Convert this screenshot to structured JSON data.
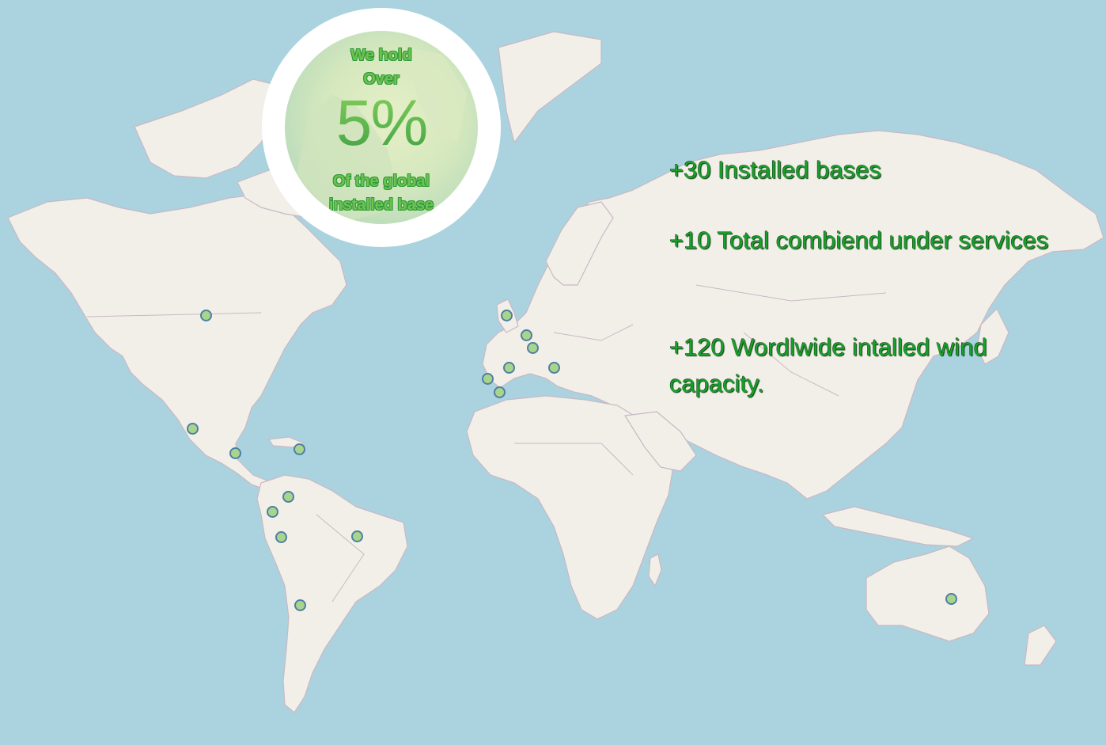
{
  "badge": {
    "line1": "We hold",
    "line2": "Over",
    "percent": "5%",
    "line3": "Of the global",
    "line4": "installed base"
  },
  "stats": {
    "installed_bases": "+30 Installed bases",
    "combined_services": "+10 Total combiend under services",
    "wind_capacity": "+120 Wordlwide intalled wind capacity."
  },
  "colors": {
    "ocean": "#aad3df",
    "land": "#f2efe9",
    "border": "#c9b8c4",
    "marker_fill": "#a8d58c",
    "marker_stroke": "#4f7fa1",
    "text_green": "#19a02a"
  },
  "markers": [
    {
      "name": "marker-canada"
    },
    {
      "name": "marker-mexico-west"
    },
    {
      "name": "marker-mexico-south"
    },
    {
      "name": "marker-caribbean"
    },
    {
      "name": "marker-colombia"
    },
    {
      "name": "marker-ecuador"
    },
    {
      "name": "marker-peru"
    },
    {
      "name": "marker-brazil"
    },
    {
      "name": "marker-chile"
    },
    {
      "name": "marker-uk"
    },
    {
      "name": "marker-belgium"
    },
    {
      "name": "marker-germany-west"
    },
    {
      "name": "marker-france"
    },
    {
      "name": "marker-italy"
    },
    {
      "name": "marker-portugal"
    },
    {
      "name": "marker-spain"
    },
    {
      "name": "marker-australia"
    }
  ]
}
